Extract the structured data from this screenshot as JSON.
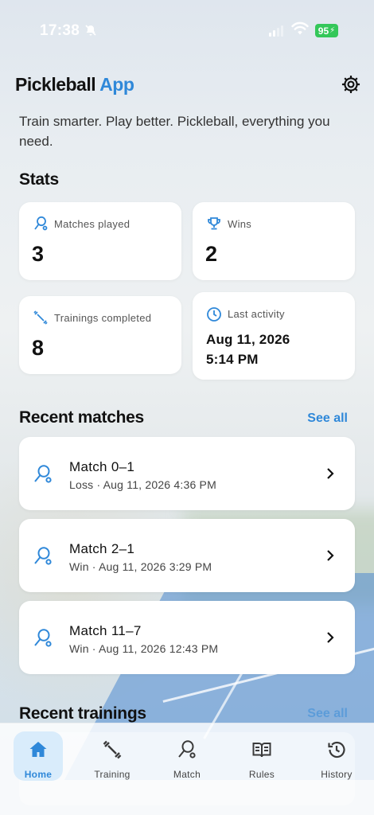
{
  "status_bar": {
    "time": "17:38",
    "battery": "95"
  },
  "header": {
    "title_main": "Pickleball",
    "title_accent": "App",
    "tagline": "Train smarter. Play better. Pickleball, everything you need."
  },
  "stats": {
    "title": "Stats",
    "matches_played": {
      "label": "Matches played",
      "value": "3"
    },
    "wins": {
      "label": "Wins",
      "value": "2"
    },
    "trainings_completed": {
      "label": "Trainings completed",
      "value": "8"
    },
    "last_activity": {
      "label": "Last activity",
      "date": "Aug 11, 2026",
      "time": "5:14 PM"
    }
  },
  "recent_matches": {
    "title": "Recent matches",
    "see_all": "See all",
    "items": [
      {
        "title": "Match 0–1",
        "subtitle": "Loss · Aug 11, 2026 4:36 PM"
      },
      {
        "title": "Match 2–1",
        "subtitle": "Win · Aug 11, 2026 3:29 PM"
      },
      {
        "title": "Match 11–7",
        "subtitle": "Win · Aug 11, 2026 12:43 PM"
      }
    ]
  },
  "recent_trainings": {
    "title": "Recent trainings",
    "see_all": "See all"
  },
  "tabs": [
    {
      "label": "Home",
      "icon": "home-icon"
    },
    {
      "label": "Training",
      "icon": "dumbbell-icon"
    },
    {
      "label": "Match",
      "icon": "paddle-icon"
    },
    {
      "label": "Rules",
      "icon": "book-icon"
    },
    {
      "label": "History",
      "icon": "history-icon"
    }
  ],
  "colors": {
    "accent": "#2f88d9",
    "battery": "#34c759"
  }
}
